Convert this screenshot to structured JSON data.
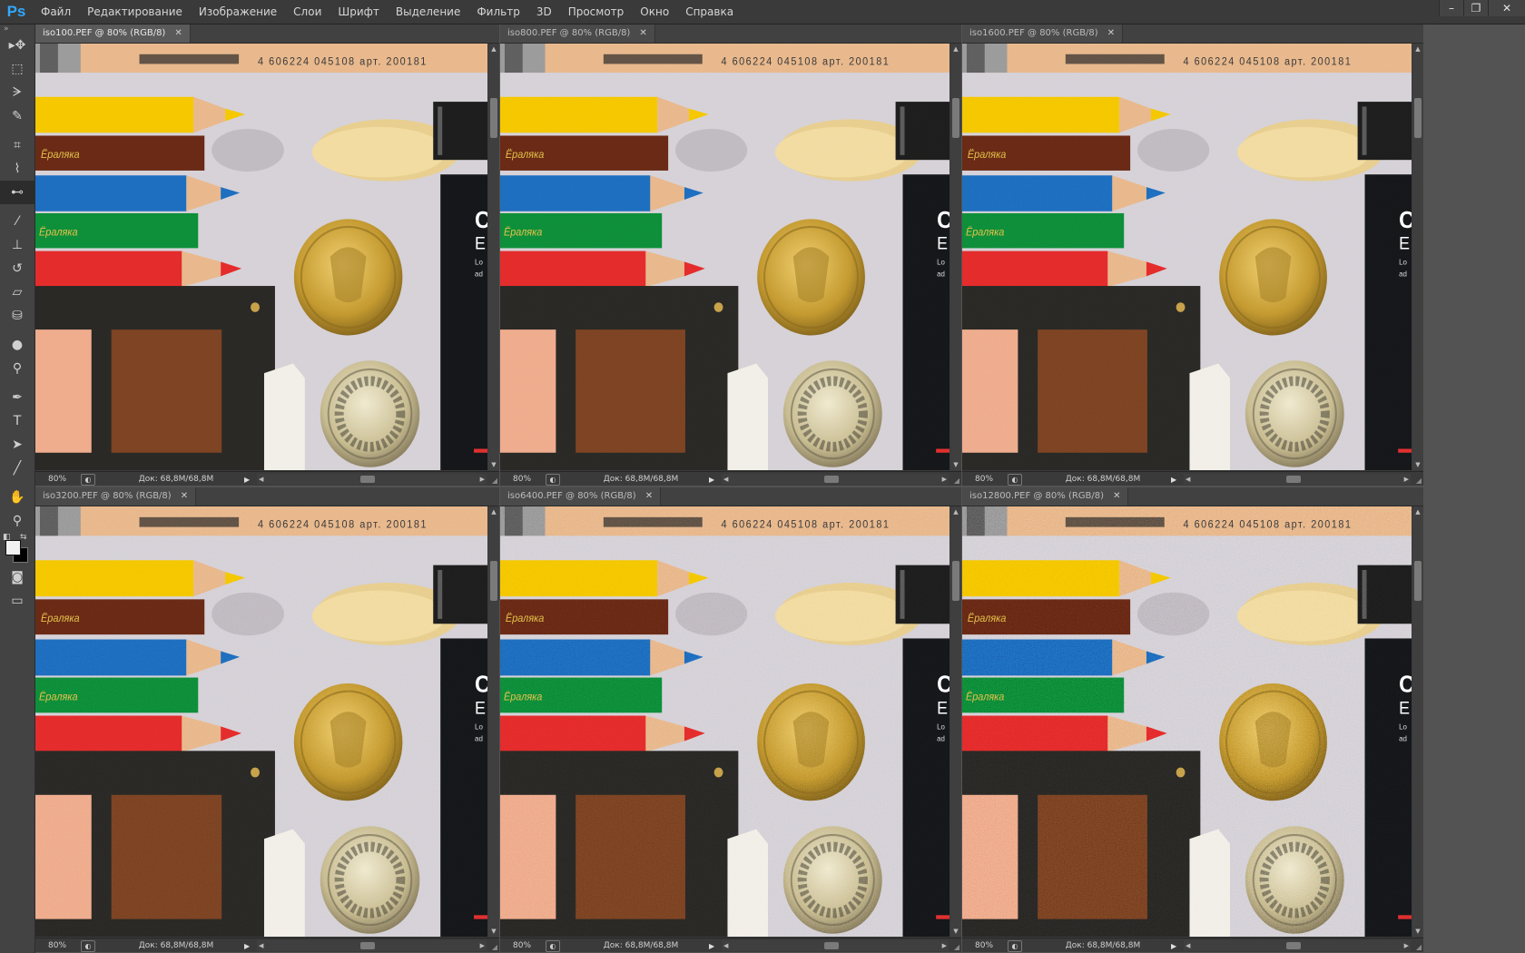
{
  "app": {
    "logo": "Ps"
  },
  "menu": [
    "Файл",
    "Редактирование",
    "Изображение",
    "Слои",
    "Шрифт",
    "Выделение",
    "Фильтр",
    "3D",
    "Просмотр",
    "Окно",
    "Справка"
  ],
  "window_controls": {
    "minimize": "–",
    "restore": "❐",
    "close": "✕"
  },
  "tools": [
    {
      "name": "move-tool",
      "icon": "move-icon",
      "glyph": "▸✥"
    },
    {
      "name": "marquee-tool",
      "icon": "rectangular-marquee-icon",
      "glyph": "⬚"
    },
    {
      "name": "lasso-tool",
      "icon": "polygonal-lasso-icon",
      "glyph": "ᗒ"
    },
    {
      "name": "quick-selection-tool",
      "icon": "quick-selection-icon",
      "glyph": "✎"
    },
    {
      "name": "crop-tool",
      "icon": "crop-icon",
      "glyph": "⌗"
    },
    {
      "name": "eyedropper-tool",
      "icon": "eyedropper-icon",
      "glyph": "⌇"
    },
    {
      "name": "healing-tool",
      "icon": "red-eye-icon",
      "glyph": "⊷",
      "active": true
    },
    {
      "name": "brush-tool",
      "icon": "brush-icon",
      "glyph": "⁄"
    },
    {
      "name": "clone-stamp-tool",
      "icon": "clone-stamp-icon",
      "glyph": "⊥"
    },
    {
      "name": "history-brush-tool",
      "icon": "history-brush-icon",
      "glyph": "↺"
    },
    {
      "name": "eraser-tool",
      "icon": "eraser-icon",
      "glyph": "▱"
    },
    {
      "name": "paint-bucket-tool",
      "icon": "paint-bucket-icon",
      "glyph": "⛁"
    },
    {
      "name": "blur-tool",
      "icon": "blur-drop-icon",
      "glyph": "●"
    },
    {
      "name": "dodge-tool",
      "icon": "dodge-icon",
      "glyph": "⚲"
    },
    {
      "name": "pen-tool",
      "icon": "pen-icon",
      "glyph": "✒"
    },
    {
      "name": "type-tool",
      "icon": "type-icon",
      "glyph": "T"
    },
    {
      "name": "path-selection-tool",
      "icon": "path-selection-icon",
      "glyph": "➤"
    },
    {
      "name": "line-tool",
      "icon": "line-icon",
      "glyph": "╱"
    },
    {
      "name": "hand-tool",
      "icon": "hand-icon",
      "glyph": "✋"
    },
    {
      "name": "zoom-tool",
      "icon": "zoom-icon",
      "glyph": "⚲"
    }
  ],
  "tools_bottom": [
    {
      "name": "quick-mask-button",
      "icon": "quick-mask-icon",
      "glyph": "◙"
    },
    {
      "name": "screen-mode-button",
      "icon": "screen-mode-icon",
      "glyph": "▭"
    }
  ],
  "documents": [
    {
      "tab": "iso100.PEF @ 80% (RGB/8)",
      "zoom": "80%",
      "doc_size": "Док: 68,8M/68,8M",
      "active": true,
      "noise": 0
    },
    {
      "tab": "iso800.PEF @ 80% (RGB/8)",
      "zoom": "80%",
      "doc_size": "Док: 68,8M/68,8M",
      "active": false,
      "noise": 0.1
    },
    {
      "tab": "iso1600.PEF @ 80% (RGB/8)",
      "zoom": "80%",
      "doc_size": "Док: 68,8M/68,8M",
      "active": false,
      "noise": 0.2
    },
    {
      "tab": "iso3200.PEF @ 80% (RGB/8)",
      "zoom": "80%",
      "doc_size": "Док: 68,8M/68,8M",
      "active": false,
      "noise": 0.35
    },
    {
      "tab": "iso6400.PEF @ 80% (RGB/8)",
      "zoom": "80%",
      "doc_size": "Док: 68,8M/68,8M",
      "active": false,
      "noise": 0.55
    },
    {
      "tab": "iso12800.PEF @ 80% (RGB/8)",
      "zoom": "80%",
      "doc_size": "Док: 68,8M/68,8M",
      "active": false,
      "noise": 0.8
    }
  ],
  "photo": {
    "barcode_text": "4 606224 045108 арт. 200181",
    "pencil_brand": "Ёраляка",
    "book_letters": [
      "C",
      "E",
      "Lo",
      "ad"
    ],
    "colors": {
      "yellow": "#f5c800",
      "brown": "#6a2a15",
      "blue": "#1e6fc0",
      "green": "#0e8f3a",
      "red": "#e52c2c",
      "wood": "#e9b98d",
      "paper": "#d6d2d8",
      "coin_gold": "#c9a33c",
      "coin_silver": "#cfc5a0",
      "card_black": "#2a2926",
      "swatch_peach": "#efad8e",
      "swatch_brown": "#7e4423"
    }
  }
}
